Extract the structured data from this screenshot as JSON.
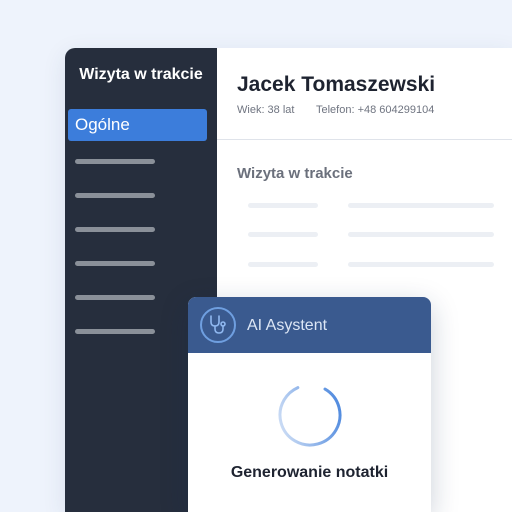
{
  "sidebar": {
    "title": "Wizyta w trakcie",
    "active_item": "Ogólne"
  },
  "patient": {
    "name": "Jacek Tomaszewski",
    "age": "Wiek: 38 lat",
    "phone": "Telefon: +48 604299104"
  },
  "main": {
    "section_title": "Wizyta w trakcie"
  },
  "ai_panel": {
    "title": "AI Asystent",
    "status": "Generowanie notatki",
    "icon": "stethoscope-icon"
  },
  "colors": {
    "sidebar_bg": "#262e3d",
    "accent": "#3c7ddb",
    "ai_header_bg": "#3a5a8f",
    "page_bg": "#eef3fc"
  }
}
